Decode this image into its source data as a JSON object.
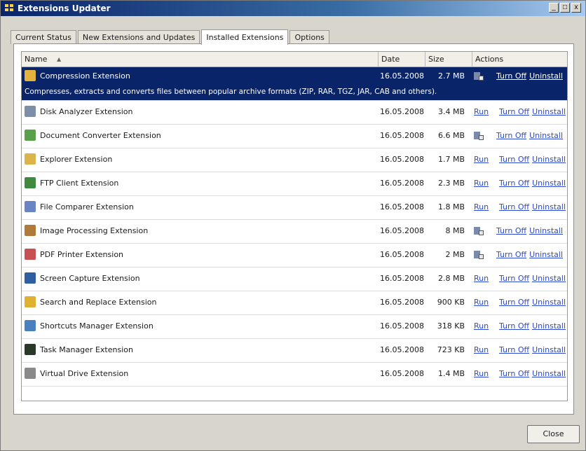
{
  "window": {
    "title": "Extensions Updater",
    "controls": [
      "_",
      "□",
      "x"
    ]
  },
  "tabs": [
    {
      "label": "Current Status",
      "active": false
    },
    {
      "label": "New Extensions and Updates",
      "active": false
    },
    {
      "label": "Installed Extensions",
      "active": true
    },
    {
      "label": "Options",
      "active": false
    }
  ],
  "table": {
    "columns": [
      "Name",
      "Date",
      "Size",
      "Actions"
    ],
    "sort_indicator": "▲",
    "rows": [
      {
        "name": "Compression Extension",
        "date": "16.05.2008",
        "size": "2.7 MB",
        "run": "",
        "turnoff": "Turn Off",
        "uninstall": "Uninstall",
        "icon": "compression-icon",
        "color": "#e3b43c",
        "selected": true,
        "description": "Compresses, extracts and converts files between popular archive formats (ZIP, RAR, TGZ, JAR, CAB and others)."
      },
      {
        "name": "Disk Analyzer Extension",
        "date": "16.05.2008",
        "size": "3.4 MB",
        "run": "Run",
        "turnoff": "Turn Off",
        "uninstall": "Uninstall",
        "icon": "disk-analyzer-icon",
        "color": "#7d8fa8"
      },
      {
        "name": "Document Converter Extension",
        "date": "16.05.2008",
        "size": "6.6 MB",
        "run": "",
        "turnoff": "Turn Off",
        "uninstall": "Uninstall",
        "icon": "document-converter-icon",
        "color": "#5aa04a"
      },
      {
        "name": "Explorer Extension",
        "date": "16.05.2008",
        "size": "1.7 MB",
        "run": "Run",
        "turnoff": "Turn Off",
        "uninstall": "Uninstall",
        "icon": "explorer-icon",
        "color": "#d9b54a"
      },
      {
        "name": "FTP Client Extension",
        "date": "16.05.2008",
        "size": "2.3 MB",
        "run": "Run",
        "turnoff": "Turn Off",
        "uninstall": "Uninstall",
        "icon": "ftp-client-icon",
        "color": "#3f8a3f"
      },
      {
        "name": "File Comparer Extension",
        "date": "16.05.2008",
        "size": "1.8 MB",
        "run": "Run",
        "turnoff": "Turn Off",
        "uninstall": "Uninstall",
        "icon": "file-comparer-icon",
        "color": "#6a84c4"
      },
      {
        "name": "Image Processing Extension",
        "date": "16.05.2008",
        "size": "8 MB",
        "run": "",
        "turnoff": "Turn Off",
        "uninstall": "Uninstall",
        "icon": "image-processing-icon",
        "color": "#b07a3a"
      },
      {
        "name": "PDF Printer Extension",
        "date": "16.05.2008",
        "size": "2 MB",
        "run": "",
        "turnoff": "Turn Off",
        "uninstall": "Uninstall",
        "icon": "pdf-printer-icon",
        "color": "#c85050"
      },
      {
        "name": "Screen Capture Extension",
        "date": "16.05.2008",
        "size": "2.8 MB",
        "run": "Run",
        "turnoff": "Turn Off",
        "uninstall": "Uninstall",
        "icon": "screen-capture-icon",
        "color": "#2f5fa0"
      },
      {
        "name": "Search and Replace Extension",
        "date": "16.05.2008",
        "size": "900 KB",
        "run": "Run",
        "turnoff": "Turn Off",
        "uninstall": "Uninstall",
        "icon": "search-replace-icon",
        "color": "#e0b030"
      },
      {
        "name": "Shortcuts Manager Extension",
        "date": "16.05.2008",
        "size": "318 KB",
        "run": "Run",
        "turnoff": "Turn Off",
        "uninstall": "Uninstall",
        "icon": "shortcuts-manager-icon",
        "color": "#4a7fc0"
      },
      {
        "name": "Task Manager Extension",
        "date": "16.05.2008",
        "size": "723 KB",
        "run": "Run",
        "turnoff": "Turn Off",
        "uninstall": "Uninstall",
        "icon": "task-manager-icon",
        "color": "#2a3a2a"
      },
      {
        "name": "Virtual Drive Extension",
        "date": "16.05.2008",
        "size": "1.4 MB",
        "run": "Run",
        "turnoff": "Turn Off",
        "uninstall": "Uninstall",
        "icon": "virtual-drive-icon",
        "color": "#8a8a8a"
      }
    ]
  },
  "footer": {
    "close_label": "Close"
  }
}
